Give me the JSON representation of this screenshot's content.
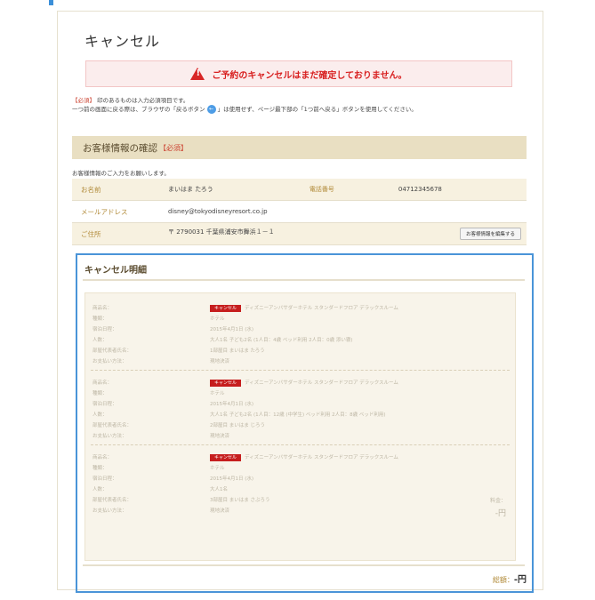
{
  "page": {
    "title": "キャンセル",
    "alert": "ご予約のキャンセルはまだ確定しておりません。",
    "note_req_prefix": "【必須】",
    "note_req_text": "印のあるものは入力必須項目です。",
    "note_back_1": "一つ前の画面に戻る際は、ブラウザの「戻るボタン",
    "note_back_icon": "←",
    "note_back_2": "」は使用せず、ページ最下部の「1つ前へ戻る」ボタンを使用してください。"
  },
  "customer": {
    "heading": "お客様情報の確認",
    "heading_req": "【必須】",
    "subtitle": "お客様情報のご入力をお願いします。",
    "name_label": "お名前",
    "name_value": "まいはま たろう",
    "phone_label": "電話番号",
    "phone_value": "04712345678",
    "email_label": "メールアドレス",
    "email_value": "disney@tokyodisneyresort.co.jp",
    "address_label": "ご住所",
    "address_value": "〒 2790031 千葉県浦安市舞浜１－１",
    "edit_button": "お客様情報を編集する"
  },
  "details": {
    "heading": "キャンセル明細",
    "labels": {
      "product": "商品名：",
      "type": "種類：",
      "date": "宿泊日程：",
      "people": "人数：",
      "rep": "部屋代表者氏名：",
      "payment": "お支払い方法："
    },
    "items": [
      {
        "badge": "キャンセル",
        "product": "ディズニーアンバサダーホテル スタンダードフロア デラックスルーム",
        "type": "ホテル",
        "date": "2015年4月1日 (水)",
        "people": "大人1名 子ども2名 (1人目：4歳 ベッド利用 2人目：0歳 添い寝)",
        "rep": "1部屋目 まいはま たろう",
        "payment": "現地決済"
      },
      {
        "badge": "キャンセル",
        "product": "ディズニーアンバサダーホテル スタンダードフロア デラックスルーム",
        "type": "ホテル",
        "date": "2015年4月1日 (水)",
        "people": "大人1名 子ども2名 (1人目：12歳 (中学生) ベッド利用 2人目：8歳 ベッド利用)",
        "rep": "2部屋目 まいはま じろう",
        "payment": "現地決済"
      },
      {
        "badge": "キャンセル",
        "product": "ディズニーアンバサダーホテル スタンダードフロア デラックスルーム",
        "type": "ホテル",
        "date": "2015年4月1日 (水)",
        "people": "大人1名",
        "rep": "3部屋目 まいはま さぶろう",
        "payment": "現地決済",
        "fee_label": "料金：",
        "fee_value": "-円"
      }
    ],
    "total_label": "総額：",
    "total_value": "-円"
  }
}
